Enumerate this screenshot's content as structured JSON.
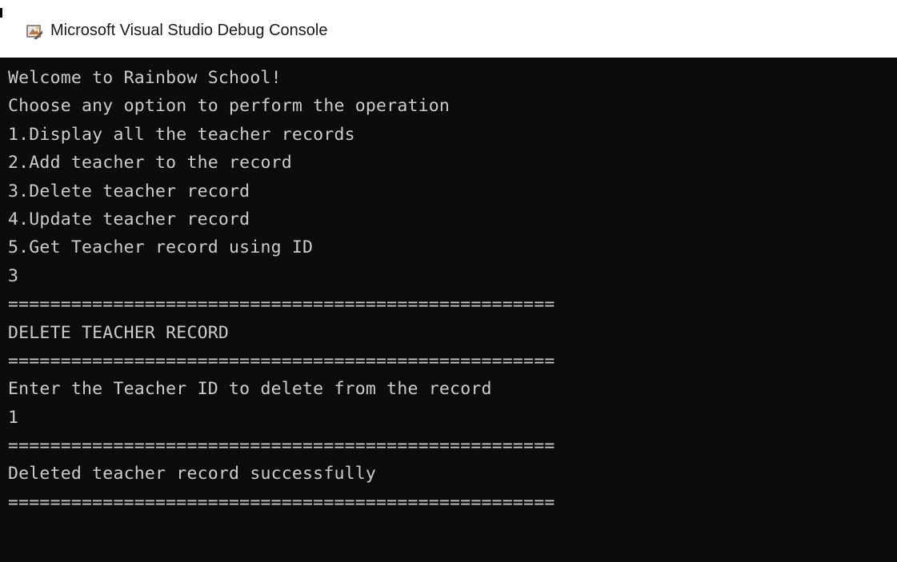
{
  "window": {
    "title": "Microsoft Visual Studio Debug Console",
    "icon": "visual-studio-debug-icon"
  },
  "console": {
    "text_color": "#cccccc",
    "background": "#0c0c0c",
    "lines": [
      "Welcome to Rainbow School!",
      "Choose any option to perform the operation",
      "1.Display all the teacher records",
      "2.Add teacher to the record",
      "3.Delete teacher record",
      "4.Update teacher record",
      "5.Get Teacher record using ID",
      "3",
      "====================================================",
      "DELETE TEACHER RECORD",
      "====================================================",
      "Enter the Teacher ID to delete from the record",
      "1",
      "====================================================",
      "Deleted teacher record successfully",
      "===================================================="
    ]
  }
}
